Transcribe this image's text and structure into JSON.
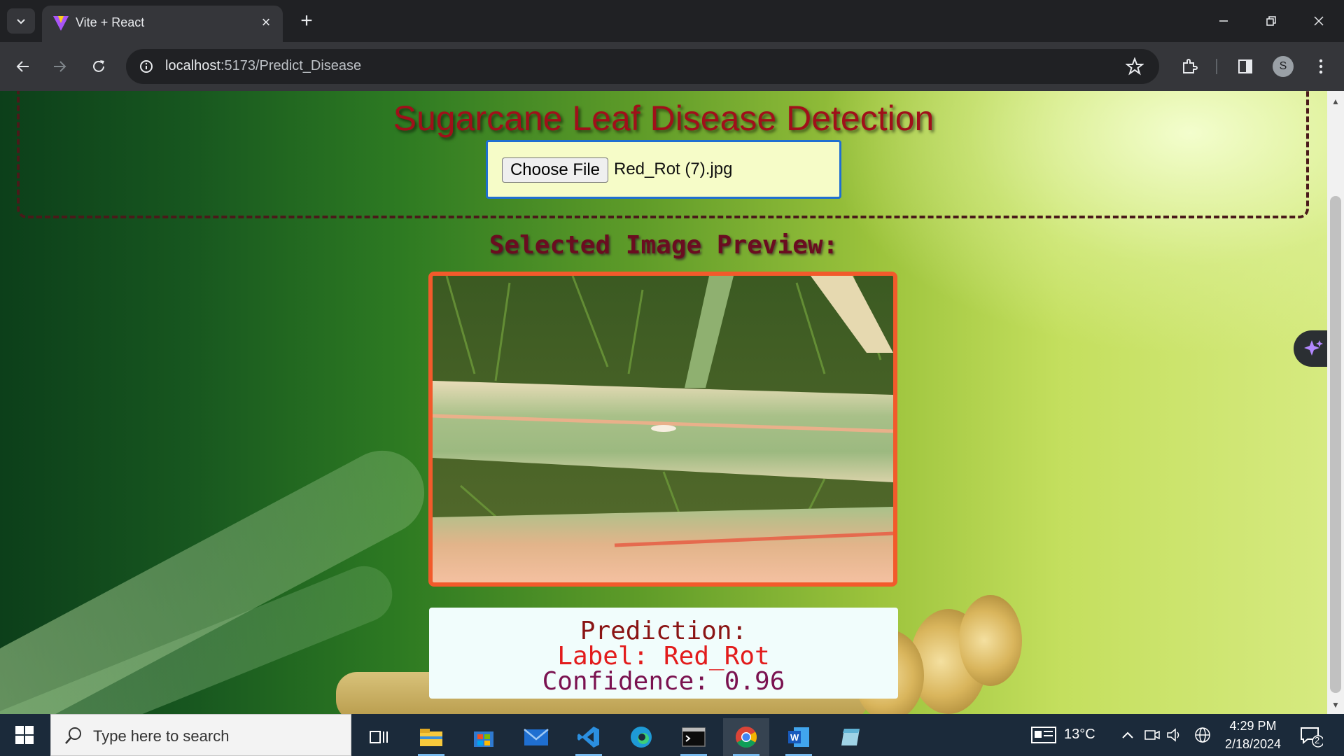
{
  "browser": {
    "tab_title": "Vite + React",
    "url_host": "localhost",
    "url_path": ":5173/Predict_Disease",
    "profile_initial": "S"
  },
  "page": {
    "title": "Sugarcane Leaf Disease Detection",
    "choose_file_label": "Choose File",
    "file_name": "Red_Rot (7).jpg",
    "preview_heading": "Selected Image Preview:",
    "prediction_heading": "Prediction:",
    "prediction_label": "Label: Red_Rot",
    "prediction_confidence": "Confidence: 0.96"
  },
  "taskbar": {
    "search_placeholder": "Type here to search",
    "temperature": "13°C",
    "time": "4:29 PM",
    "date": "2/18/2024",
    "notification_count": "2"
  },
  "colors": {
    "title": "#a0101a",
    "file_box_border": "#1f6fd1",
    "preview_border": "#f25a2b",
    "label_text": "#e21c1c"
  }
}
